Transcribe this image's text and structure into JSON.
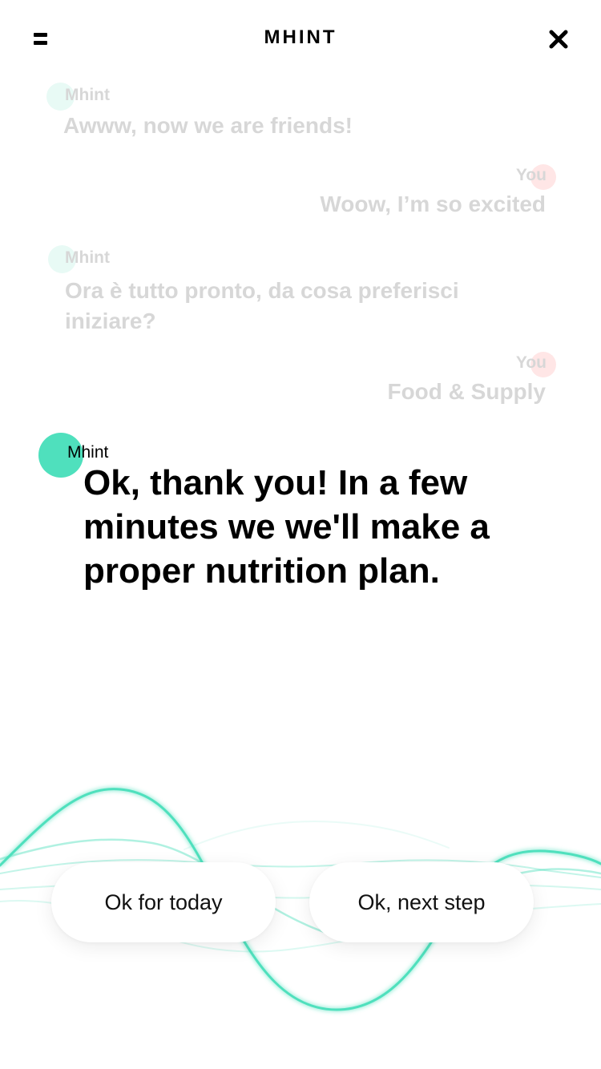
{
  "header": {
    "title": "MHINT",
    "menu_icon": "hamburger-menu-icon",
    "close_icon": "close-icon"
  },
  "colors": {
    "accent_green": "#4fe0bd",
    "user_pink": "#ffd9d9",
    "faded_text": "#d7d7d7"
  },
  "conversation": {
    "history": [
      {
        "sender": "Mhint",
        "text": "Awww, now we are friends!"
      },
      {
        "sender": "You",
        "text": "Woow, I’m so excited"
      },
      {
        "sender": "Mhint",
        "line1": "Ora è tutto pronto, da cosa preferisci",
        "line2": "iniziare?"
      },
      {
        "sender": "You",
        "text": "Food & Supply"
      }
    ],
    "current": {
      "sender": "Mhint",
      "line1": "Ok, thank you! In a few",
      "line2": "minutes we we'll make a",
      "line3": "proper nutrition plan."
    }
  },
  "actions": {
    "left_label": "Ok for today",
    "right_label": "Ok, next step"
  }
}
